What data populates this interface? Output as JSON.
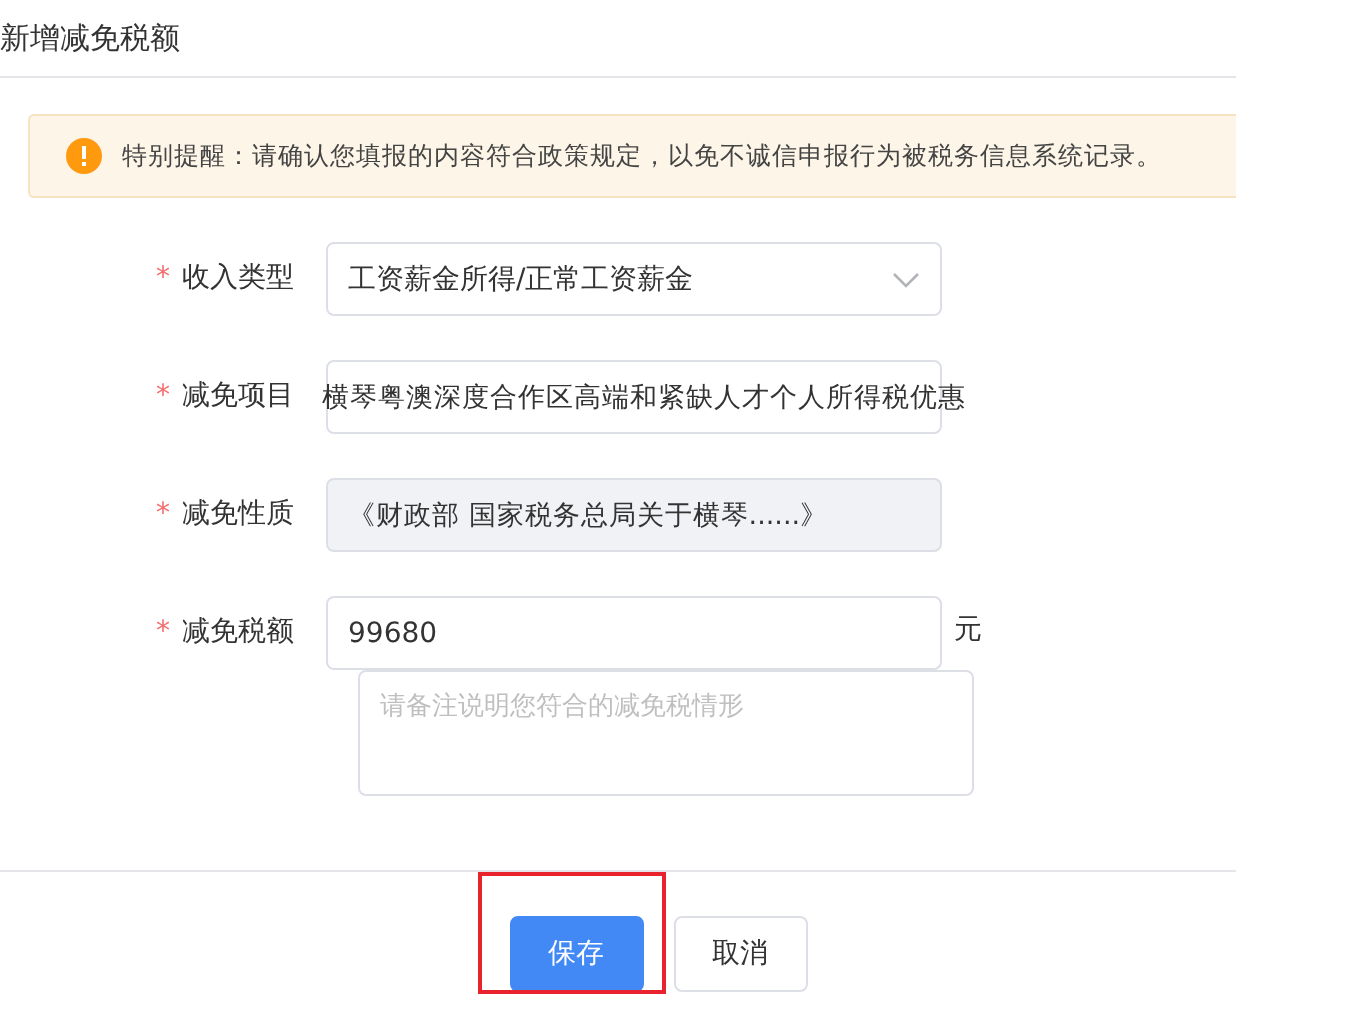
{
  "dialog": {
    "title": "新增减免税额"
  },
  "notice": {
    "text": "特别提醒：请确认您填报的内容符合政策规定，以免不诚信申报行为被税务信息系统记录。"
  },
  "fields": [
    {
      "kind": "select",
      "label": "收入类型",
      "required": "*",
      "value": "工资薪金所得/正常工资薪金"
    },
    {
      "kind": "text",
      "label": "减免项目",
      "required": "*",
      "value": "横琴粤澳深度合作区高端和紧缺人才个人所得税优惠"
    },
    {
      "kind": "text",
      "label": "减免性质",
      "required": "*",
      "value": "《财政部 国家税务总局关于横琴......》",
      "disabled": true
    },
    {
      "kind": "amount",
      "label": "减免税额",
      "required": "*",
      "value": "99680",
      "unit": "元"
    },
    {
      "kind": "textarea",
      "placeholder": "请备注说明您符合的减免税情形"
    }
  ],
  "buttons": [
    {
      "kind": "primary",
      "label": "保存",
      "highlighted": true
    },
    {
      "kind": "default",
      "label": "取消",
      "highlighted": false
    }
  ]
}
